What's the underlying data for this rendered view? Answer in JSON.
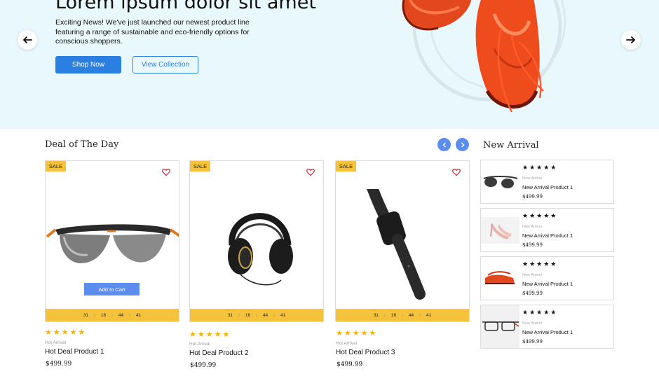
{
  "hero": {
    "title": "Lorem ipsum dolor sit amet",
    "description": "Exciting News! We've just launched our newest product line featuring a range of sustainable and eco-friendly options for conscious shoppers.",
    "shop_now": "Shop Now",
    "view_collection": "View  Collection",
    "prev_icon": "arrow-left-icon",
    "next_icon": "arrow-right-icon"
  },
  "deals": {
    "title": "Deal of The Day",
    "items": [
      {
        "badge": "SALE",
        "category": "Hot Arrival",
        "name": "Hot Deal Product 1",
        "price": "$499.99",
        "timer": [
          "31",
          "16",
          "44",
          "41"
        ],
        "add_to_cart": "Add to Cart",
        "rating": 5,
        "image": "sunglasses"
      },
      {
        "badge": "SALE",
        "category": "Hot Arrival",
        "name": "Hot Deal Product 2",
        "price": "$499.99",
        "timer": [
          "31",
          "16",
          "44",
          "41"
        ],
        "rating": 5,
        "image": "headphones"
      },
      {
        "badge": "SALE",
        "category": "Hot Arrival",
        "name": "Hot Deal Product 3",
        "price": "$499.99",
        "timer": [
          "31",
          "16",
          "44",
          "41"
        ],
        "rating": 5,
        "image": "smartwatch"
      }
    ]
  },
  "new_arrival": {
    "title": "New Arrival",
    "items": [
      {
        "stars": "★★★★★",
        "category": "New Arrival",
        "name": "New Arrival Product 1",
        "price": "$499.99",
        "image": "sunglasses"
      },
      {
        "stars": "★★★★★",
        "category": "New Arrival",
        "name": "New Arrival Product 1",
        "price": "$499.99",
        "image": "high-heels"
      },
      {
        "stars": "★★★★★",
        "category": "New Arrival",
        "name": "New Arrival Product 1",
        "price": "$499.99",
        "image": "sneakers"
      },
      {
        "stars": "★★★★★",
        "category": "New Arrival",
        "name": "New Arrival Product 1",
        "price": "$499.99",
        "image": "eyeglasses"
      }
    ]
  },
  "colors": {
    "accent": "#2b7fe0",
    "button": "#5b8def",
    "sale": "#f5c33b",
    "star": "#f5b400",
    "hero_bg": "#e9f8fd"
  }
}
